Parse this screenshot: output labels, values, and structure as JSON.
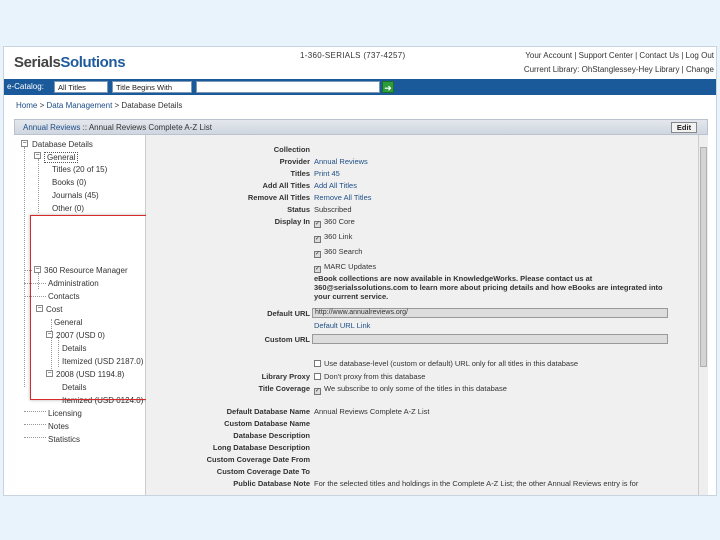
{
  "header": {
    "logo_part1": "Serials",
    "logo_part2": "Solutions",
    "subscriber": "1-360-SERIALS (737-4257)",
    "links_row1": "Your Account | Support Center | Contact Us | Log Out",
    "links_row2": "Current Library: OhStanglessey-Hey Library | Change"
  },
  "search": {
    "label": "e-Catalog:",
    "scope_value": "All Titles",
    "match_value": "Title Begins With",
    "query_value": "",
    "go_icon": "arrow-right-icon"
  },
  "breadcrumb": {
    "home": "Home",
    "sep1": " > ",
    "data_management": "Data Management",
    "sep2": " > ",
    "current": "Database Details"
  },
  "panel": {
    "title_link": "Annual Reviews",
    "title_sep": " :: ",
    "title_rest": "Annual Reviews Complete A-Z List",
    "edit_label": "Edit"
  },
  "tree": {
    "root": "Database Details",
    "general": "General",
    "titles": "Titles (20 of 15)",
    "books": "Books (0)",
    "journals": "Journals (45)",
    "other": "Other (0)",
    "erm": "360 Resource Manager",
    "administration": "Administration",
    "contacts": "Contacts",
    "cost": "Cost",
    "general2": "General",
    "y2007": "2007 (USD 0)",
    "details1": "Details",
    "itemized1": "Itemized (USD 2187.0)",
    "y2008": "2008 (USD 1194.8)",
    "details2": "Details",
    "itemized2": "Itemized (USD 0124.0)",
    "licensing": "Licensing",
    "notes": "Notes",
    "statistics": "Statistics"
  },
  "details": {
    "collection_label": "Collection",
    "collection_value": "",
    "provider_label": "Provider",
    "provider_value": "Annual Reviews",
    "titles_label": "Titles",
    "titles_value": "Print 45",
    "add_all_label": "Add All Titles",
    "add_all_value": "Add All Titles",
    "remove_all_label": "Remove All Titles",
    "remove_all_value": "Remove All Titles",
    "status_label": "Status",
    "status_value": "Subscribed",
    "display_label": "Display In",
    "display_opts": [
      "360 Core",
      "360 Link",
      "360 Search",
      "MARC Updates"
    ],
    "ebook_notice_1": "eBook collections are now available in KnowledgeWorks. Please contact us at",
    "ebook_notice_2": "360@serialssolutions.com to learn more about pricing details and how eBooks are integrated into",
    "ebook_notice_3": "your current service.",
    "default_url_label": "Default URL",
    "default_url_value": "http://www.annualreviews.org/",
    "default_url_link": "Default URL Link",
    "custom_url_label": "Custom URL",
    "custom_url_value": "",
    "opt_url": "Use database-level (custom or default) URL only for all titles in this database",
    "library_proxy_label": "Library Proxy",
    "opt_proxy": "Don't proxy from this database",
    "title_coverage_label": "Title Coverage",
    "opt_coverage": "We subscribe to only some of the titles in this database",
    "default_db_name_label": "Default Database Name",
    "default_db_name_value": "Annual Reviews Complete A-Z List",
    "custom_db_name_label": "Custom Database Name",
    "db_desc_label": "Database Description",
    "long_db_desc_label": "Long Database Description",
    "custom_cov_from_label": "Custom Coverage Date From",
    "custom_cov_to_label": "Custom Coverage Date To",
    "public_note_label": "Public Database Note",
    "public_note_value": "For the selected titles and holdings in the Complete A-Z List; the other Annual Reviews entry is for"
  }
}
